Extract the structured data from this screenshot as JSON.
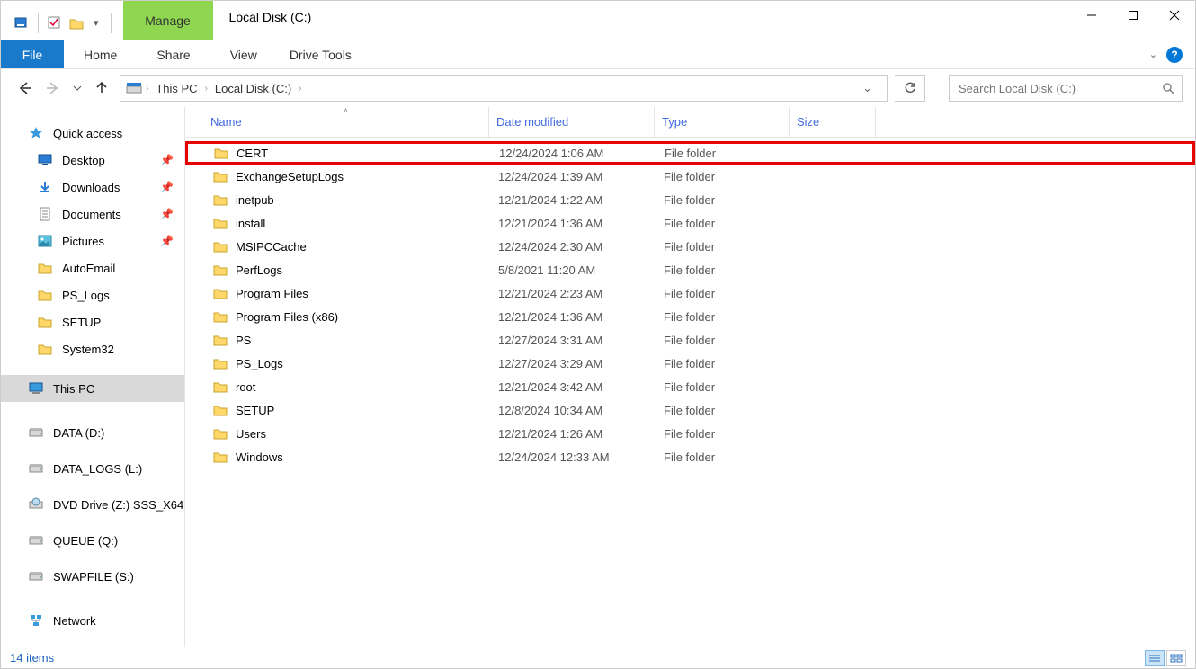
{
  "window": {
    "title": "Local Disk (C:)",
    "context_tab": "Manage",
    "context_sub": "Drive Tools"
  },
  "ribbon": {
    "file": "File",
    "tabs": [
      "Home",
      "Share",
      "View"
    ]
  },
  "breadcrumb": [
    "This PC",
    "Local Disk (C:)"
  ],
  "search": {
    "placeholder": "Search Local Disk (C:)"
  },
  "sidebar": {
    "quick": "Quick access",
    "quick_items": [
      {
        "label": "Desktop",
        "icon": "desktop",
        "pinned": true
      },
      {
        "label": "Downloads",
        "icon": "download",
        "pinned": true
      },
      {
        "label": "Documents",
        "icon": "document",
        "pinned": true
      },
      {
        "label": "Pictures",
        "icon": "pictures",
        "pinned": true
      },
      {
        "label": "AutoEmail",
        "icon": "folder",
        "pinned": false
      },
      {
        "label": "PS_Logs",
        "icon": "folder",
        "pinned": false
      },
      {
        "label": "SETUP",
        "icon": "folder",
        "pinned": false
      },
      {
        "label": "System32",
        "icon": "folder",
        "pinned": false
      }
    ],
    "thispc": "This PC",
    "drives": [
      {
        "label": "DATA (D:)",
        "icon": "drive"
      },
      {
        "label": "DATA_LOGS (L:)",
        "icon": "drive"
      },
      {
        "label": "DVD Drive (Z:) SSS_X64",
        "icon": "dvd"
      },
      {
        "label": "QUEUE (Q:)",
        "icon": "drive"
      },
      {
        "label": "SWAPFILE (S:)",
        "icon": "drive"
      }
    ],
    "network": "Network"
  },
  "columns": {
    "name": "Name",
    "date": "Date modified",
    "type": "Type",
    "size": "Size"
  },
  "files": [
    {
      "name": "CERT",
      "date": "12/24/2024 1:06 AM",
      "type": "File folder",
      "hl": true
    },
    {
      "name": "ExchangeSetupLogs",
      "date": "12/24/2024 1:39 AM",
      "type": "File folder"
    },
    {
      "name": "inetpub",
      "date": "12/21/2024 1:22 AM",
      "type": "File folder"
    },
    {
      "name": "install",
      "date": "12/21/2024 1:36 AM",
      "type": "File folder"
    },
    {
      "name": "MSIPCCache",
      "date": "12/24/2024 2:30 AM",
      "type": "File folder"
    },
    {
      "name": "PerfLogs",
      "date": "5/8/2021 11:20 AM",
      "type": "File folder"
    },
    {
      "name": "Program Files",
      "date": "12/21/2024 2:23 AM",
      "type": "File folder"
    },
    {
      "name": "Program Files (x86)",
      "date": "12/21/2024 1:36 AM",
      "type": "File folder"
    },
    {
      "name": "PS",
      "date": "12/27/2024 3:31 AM",
      "type": "File folder"
    },
    {
      "name": "PS_Logs",
      "date": "12/27/2024 3:29 AM",
      "type": "File folder"
    },
    {
      "name": "root",
      "date": "12/21/2024 3:42 AM",
      "type": "File folder"
    },
    {
      "name": "SETUP",
      "date": "12/8/2024 10:34 AM",
      "type": "File folder"
    },
    {
      "name": "Users",
      "date": "12/21/2024 1:26 AM",
      "type": "File folder"
    },
    {
      "name": "Windows",
      "date": "12/24/2024 12:33 AM",
      "type": "File folder"
    }
  ],
  "status": "14 items"
}
